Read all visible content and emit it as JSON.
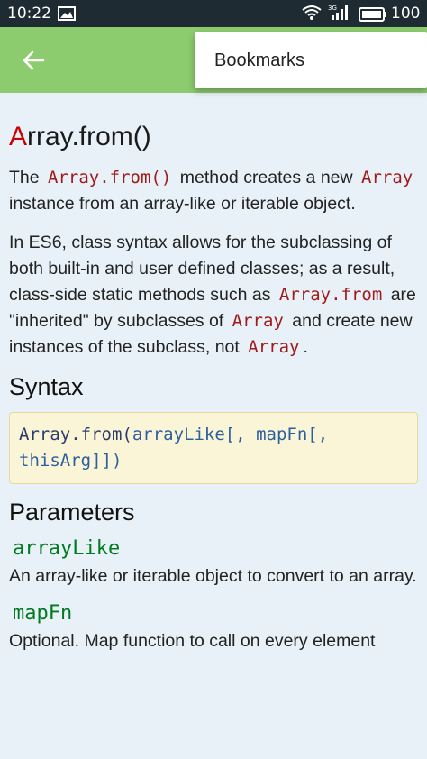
{
  "status": {
    "time": "10:22",
    "battery": "100",
    "network": "3G"
  },
  "appbar": {
    "menu_item": "Bookmarks"
  },
  "article": {
    "title_first": "A",
    "title_rest": "rray.from()",
    "p1": {
      "t1": "The",
      "c1": "Array.from()",
      "t2": "method creates a new",
      "c2": "Array",
      "t3": "instance from an array-like or iterable object."
    },
    "p2": {
      "t1": "In ES6, class syntax allows for the subclassing of both built-in and user defined classes; as a result, class-side static methods such as",
      "c1": "Array.from",
      "t2": "are \"inherited\" by subclasses of",
      "c2": "Array",
      "t3": "and create new instances of the subclass, not",
      "c3": "Array",
      "t4": "."
    },
    "syntax_heading": "Syntax",
    "syntax": {
      "fn": "Array.from(",
      "a1": "arrayLike",
      "rest": "[, mapFn[, thisArg]])"
    },
    "params_heading": "Parameters",
    "params": [
      {
        "name": "arrayLike",
        "desc": "An array-like or iterable object to convert to an array."
      },
      {
        "name": "mapFn",
        "desc": "Optional. Map function to call on every element"
      }
    ]
  }
}
